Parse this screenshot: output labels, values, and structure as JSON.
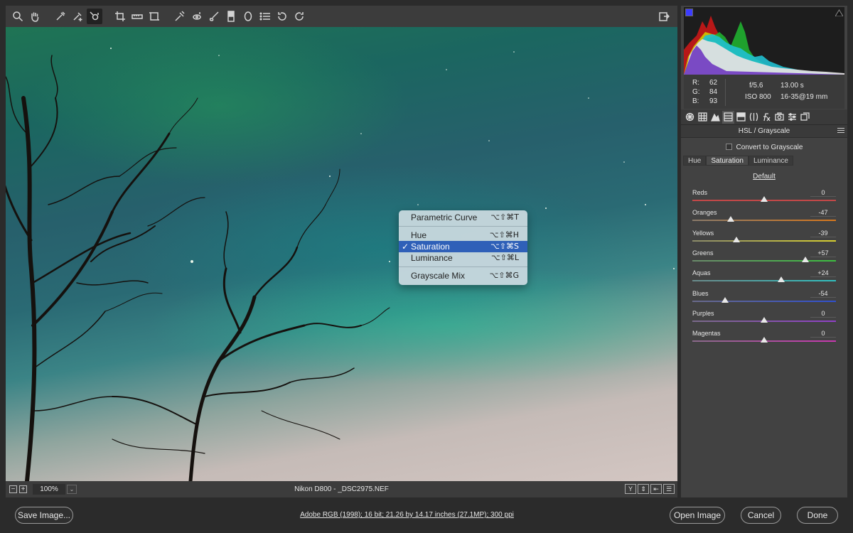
{
  "toolbar": {
    "tools": [
      "zoom-icon",
      "hand-icon",
      "white-balance-icon",
      "color-sampler-icon",
      "targeted-adjustment-icon",
      "crop-icon",
      "straighten-icon",
      "transform-icon",
      "spot-removal-icon",
      "red-eye-icon",
      "adjustment-brush-icon",
      "graduated-filter-icon",
      "radial-filter-icon",
      "preferences-icon",
      "rotate-ccw-icon",
      "rotate-cw-icon"
    ],
    "active_tool": "targeted-adjustment-icon"
  },
  "histogram": {
    "rgb": {
      "r_label": "R:",
      "r": "62",
      "g_label": "G:",
      "g": "84",
      "b_label": "B:",
      "b": "93"
    },
    "camera": {
      "aperture": "f/5.6",
      "shutter": "13.00 s",
      "iso": "ISO 800",
      "lens": "16-35@19 mm"
    }
  },
  "panel": {
    "title": "HSL / Grayscale",
    "convert_grayscale": "Convert to Grayscale",
    "sub_tabs": [
      "Hue",
      "Saturation",
      "Luminance"
    ],
    "active_sub_tab": "Saturation",
    "default_link": "Default",
    "sliders": [
      {
        "label": "Reds",
        "value": "0",
        "num": 0,
        "colors": [
          "#c44848",
          "#c44848"
        ]
      },
      {
        "label": "Oranges",
        "value": "-47",
        "num": -47,
        "colors": [
          "#8a7a6a",
          "#d8781c"
        ]
      },
      {
        "label": "Yellows",
        "value": "-39",
        "num": -39,
        "colors": [
          "#8a8a6a",
          "#d8d030"
        ]
      },
      {
        "label": "Greens",
        "value": "+57",
        "num": 57,
        "colors": [
          "#6a8a6a",
          "#3cc040"
        ]
      },
      {
        "label": "Aquas",
        "value": "+24",
        "num": 24,
        "colors": [
          "#6a8a8a",
          "#30c0c0"
        ]
      },
      {
        "label": "Blues",
        "value": "-54",
        "num": -54,
        "colors": [
          "#6a6a8a",
          "#3050d0"
        ]
      },
      {
        "label": "Purples",
        "value": "0",
        "num": 0,
        "colors": [
          "#7a6a8a",
          "#9040c8"
        ]
      },
      {
        "label": "Magentas",
        "value": "0",
        "num": 0,
        "colors": [
          "#8a6a8a",
          "#c838b0"
        ]
      }
    ]
  },
  "context_menu": {
    "items": [
      {
        "label": "Parametric Curve",
        "shortcut": "⌥⇧⌘T"
      },
      {
        "label": "Hue",
        "shortcut": "⌥⇧⌘H"
      },
      {
        "label": "Saturation",
        "shortcut": "⌥⇧⌘S",
        "checkmark": "✓"
      },
      {
        "label": "Luminance",
        "shortcut": "⌥⇧⌘L"
      },
      {
        "label": "Grayscale Mix",
        "shortcut": "⌥⇧⌘G"
      }
    ]
  },
  "status": {
    "zoom": "100%",
    "zoom_out": "−",
    "zoom_in": "+",
    "zoom_drop": "⌄",
    "file": "Nikon D800  -  _DSC2975.NEF",
    "view_buttons": [
      "Y",
      "⇕",
      "⇤",
      "☰"
    ]
  },
  "footer": {
    "save": "Save Image...",
    "workflow": "Adobe RGB (1998); 16 bit; 21.26 by 14.17 inches (27.1MP); 300 ppi",
    "open": "Open Image",
    "cancel": "Cancel",
    "done": "Done"
  },
  "colors": {
    "menu_highlight": "#2f60b8",
    "panel_bg": "#424242"
  }
}
